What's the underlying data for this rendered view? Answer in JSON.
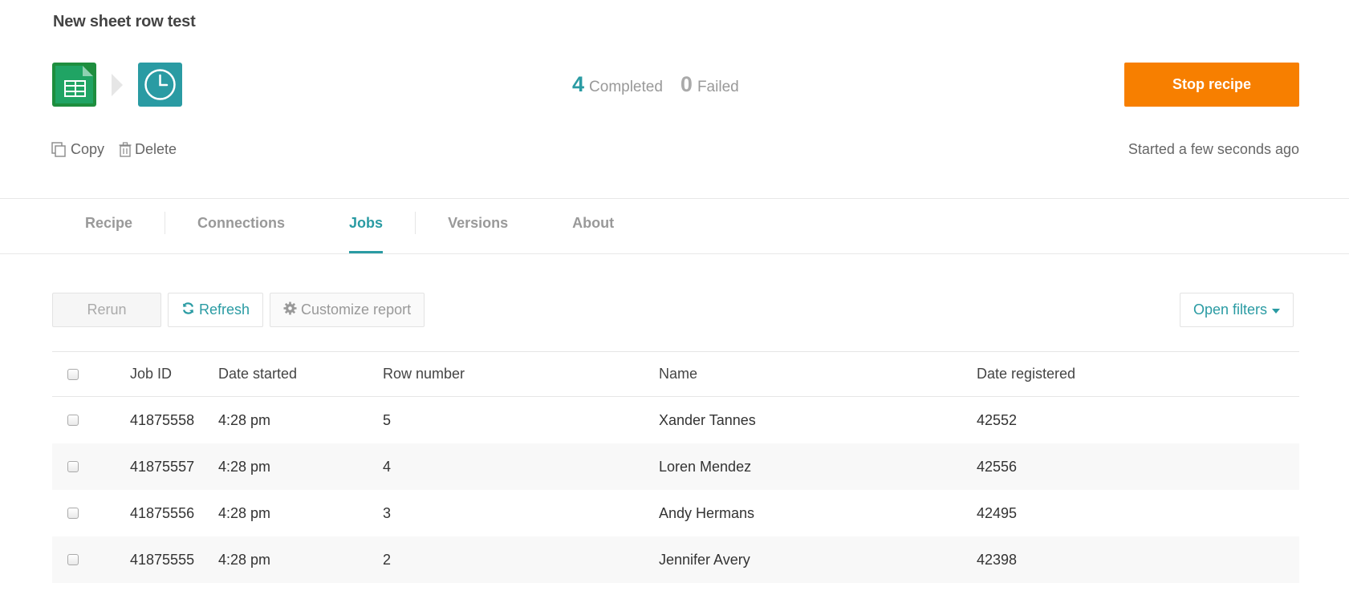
{
  "recipe": {
    "title": "New sheet row test"
  },
  "flow": {
    "trigger_app_icon": "google-sheets-icon",
    "action_app_icon": "clock-icon"
  },
  "stats": {
    "completed_count": "4",
    "completed_label": "Completed",
    "failed_count": "0",
    "failed_label": "Failed"
  },
  "header_actions": {
    "stop_label": "Stop recipe",
    "copy_label": "Copy",
    "delete_label": "Delete",
    "started_text": "Started a few seconds ago"
  },
  "tabs": [
    {
      "label": "Recipe",
      "active": false
    },
    {
      "label": "Connections",
      "active": false
    },
    {
      "label": "Jobs",
      "active": true
    },
    {
      "label": "Versions",
      "active": false
    },
    {
      "label": "About",
      "active": false
    }
  ],
  "toolbar": {
    "rerun_label": "Rerun",
    "refresh_label": "Refresh",
    "customize_label": "Customize report",
    "open_filters_label": "Open filters"
  },
  "table": {
    "columns": [
      "Job ID",
      "Date started",
      "Row number",
      "Name",
      "Date registered"
    ],
    "rows": [
      [
        "41875558",
        "4:28 pm",
        "5",
        "Xander Tannes",
        "42552"
      ],
      [
        "41875557",
        "4:28 pm",
        "4",
        "Loren Mendez",
        "42556"
      ],
      [
        "41875556",
        "4:28 pm",
        "3",
        "Andy Hermans",
        "42495"
      ],
      [
        "41875555",
        "4:28 pm",
        "2",
        "Jennifer Avery",
        "42398"
      ]
    ]
  },
  "colors": {
    "accent": "#2a9ba3",
    "stop_button": "#f77f00",
    "sheets_green": "#20a464"
  }
}
